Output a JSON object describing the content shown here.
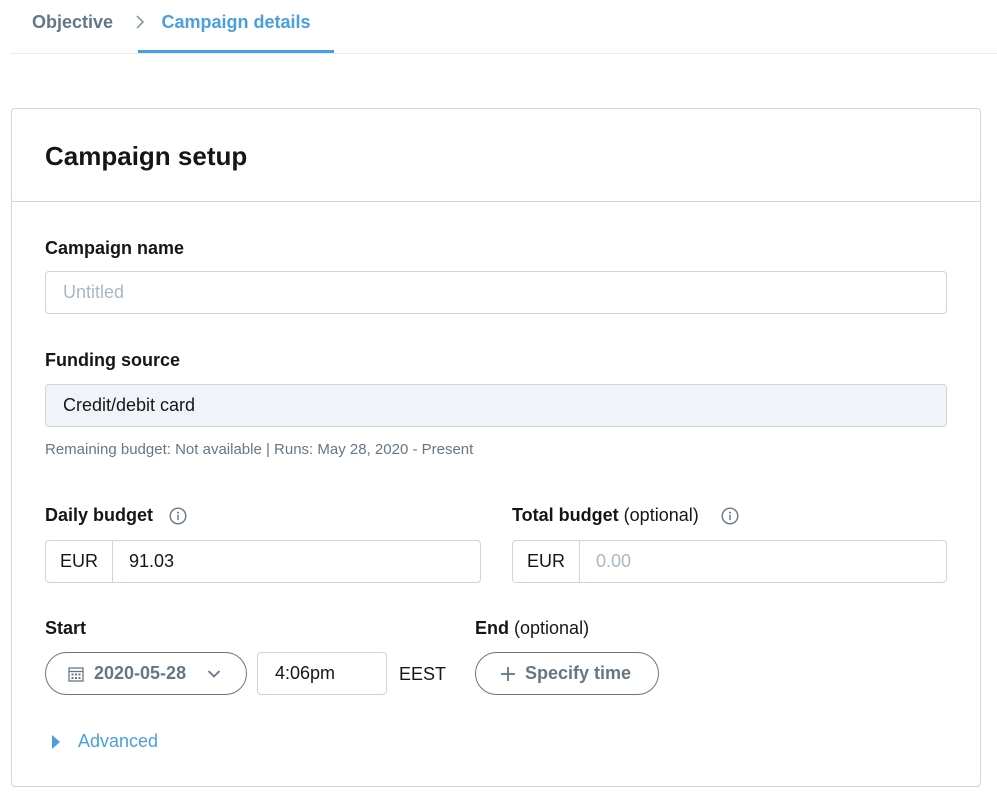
{
  "breadcrumb": {
    "steps": [
      "Objective",
      "Campaign details"
    ],
    "active_index": 1
  },
  "card": {
    "title": "Campaign setup"
  },
  "campaign_name": {
    "label": "Campaign name",
    "placeholder": "Untitled",
    "value": ""
  },
  "funding_source": {
    "label": "Funding source",
    "value": "Credit/debit card",
    "hint": "Remaining budget: Not available | Runs: May 28, 2020 - Present"
  },
  "daily_budget": {
    "label": "Daily budget",
    "currency": "EUR",
    "value": "91.03"
  },
  "total_budget": {
    "label": "Total budget",
    "optional": "(optional)",
    "currency": "EUR",
    "placeholder": "0.00"
  },
  "start": {
    "label": "Start",
    "date": "2020-05-28",
    "time": "4:06pm",
    "timezone": "EEST"
  },
  "end": {
    "label": "End",
    "optional": "(optional)",
    "button_label": "Specify time"
  },
  "advanced": {
    "label": "Advanced"
  },
  "colors": {
    "accent": "#4a9fe0",
    "text": "#14171a",
    "muted": "#657786",
    "border": "#ccd6dd",
    "filled_bg": "#f0f4f8"
  }
}
